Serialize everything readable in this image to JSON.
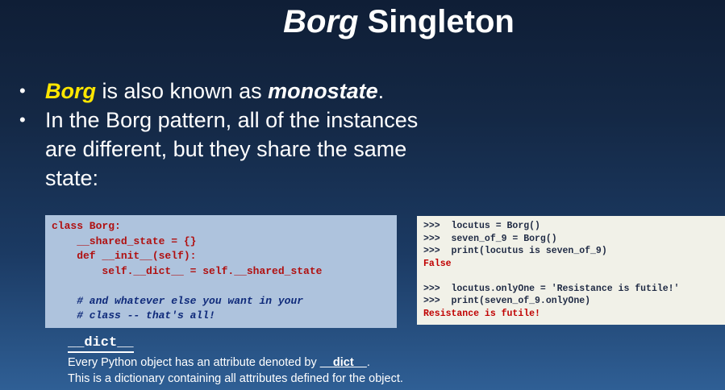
{
  "title": {
    "italic": "Borg",
    "rest": " Singleton"
  },
  "bullets": [
    {
      "pre": "",
      "highlight": "Borg",
      "mid": " is also known as ",
      "bold_italic": "monostate",
      "post": "."
    },
    {
      "text": "In the Borg pattern, all of the instances are different, but they share the same state:"
    }
  ],
  "code_left": {
    "lines": [
      "class Borg:",
      "    __shared_state = {}",
      "    def __init__(self):",
      "        self.__dict__ = self.__shared_state",
      "",
      "    # and whatever else you want in your",
      "    # class -- that's all!"
    ]
  },
  "code_right": {
    "lines": [
      ">>>  locutus = Borg()",
      ">>>  seven_of_9 = Borg()",
      ">>>  print(locutus is seven_of_9)",
      "False",
      "",
      ">>>  locutus.onlyOne = 'Resistance is futile!'",
      ">>>  print(seven_of_9.onlyOne)",
      "Resistance is futile!"
    ]
  },
  "dict_note": {
    "heading": "__dict__",
    "line1_pre": "Every Python object has an attribute denoted by ",
    "line1_bold": "__dict__",
    "line1_post": ".",
    "line2": "This is a dictionary containing all attributes defined for the object."
  }
}
